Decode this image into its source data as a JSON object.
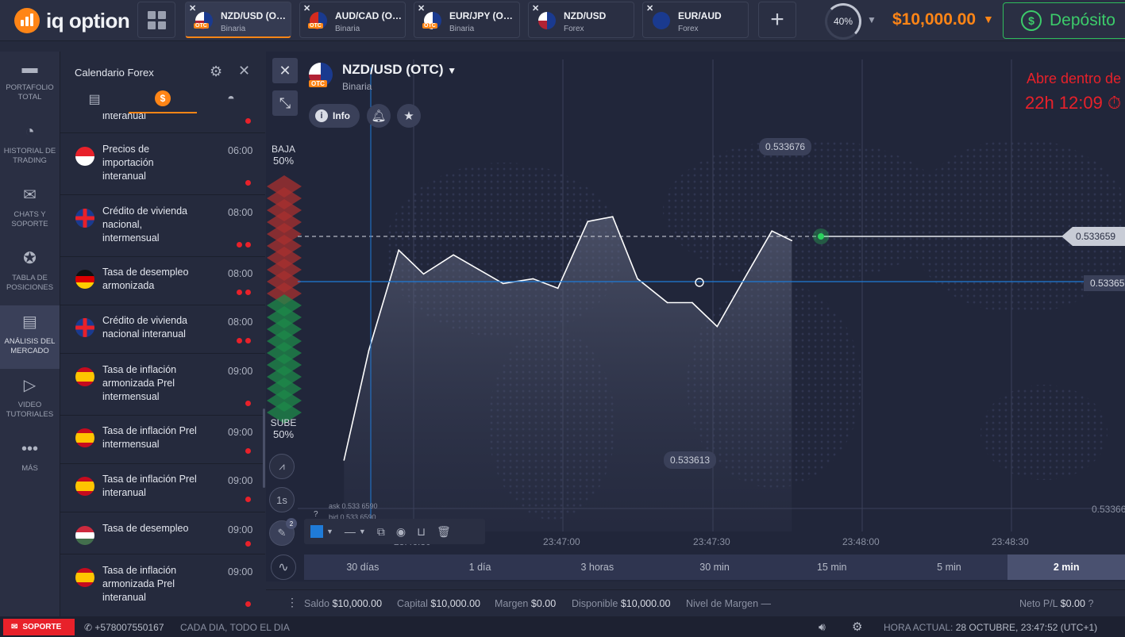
{
  "header": {
    "logo": "iq option",
    "tabs": [
      {
        "name": "NZD/USD (OTC)",
        "type": "Binaria",
        "otc": "OTC",
        "active": true
      },
      {
        "name": "AUD/CAD (OTC)",
        "type": "Binaria",
        "otc": "OTC",
        "active": false
      },
      {
        "name": "EUR/JPY (OTC)",
        "type": "Binaria",
        "otc": "OTC",
        "active": false
      },
      {
        "name": "NZD/USD",
        "type": "Forex",
        "otc": "",
        "active": false
      },
      {
        "name": "EUR/AUD",
        "type": "Forex",
        "otc": "",
        "active": false
      }
    ],
    "close_glyph": "✕",
    "add_glyph": "+",
    "profit_percent": "40%",
    "balance": "$10,000.00",
    "deposit_label": "Depósito"
  },
  "sidebar": {
    "items": [
      {
        "label": "PORTAFOLIO TOTAL",
        "icon": "briefcase-icon",
        "glyph": "▬"
      },
      {
        "label": "HISTORIAL DE TRADING",
        "icon": "history-icon",
        "glyph": "◔"
      },
      {
        "label": "CHATS Y SOPORTE",
        "icon": "chat-icon",
        "glyph": "✉"
      },
      {
        "label": "TABLA DE POSICIONES",
        "icon": "medal-icon",
        "glyph": "✪"
      },
      {
        "label": "ANÁLISIS DEL MERCADO",
        "icon": "newspaper-icon",
        "glyph": "▤",
        "active": true
      },
      {
        "label": "VIDEO TUTORIALES",
        "icon": "play-icon",
        "glyph": "▷"
      },
      {
        "label": "MÁS",
        "icon": "more-icon",
        "glyph": "•••"
      }
    ]
  },
  "calendar": {
    "title": "Calendario Forex",
    "partial_row": "interanual",
    "events": [
      {
        "flag": "sg",
        "name": "Precios de importación interanual",
        "time": "06:00",
        "impact": 1
      },
      {
        "flag": "gb",
        "name": "Crédito de vivienda nacional, intermensual",
        "time": "08:00",
        "impact": 2
      },
      {
        "flag": "de",
        "name": "Tasa de desempleo armonizada",
        "time": "08:00",
        "impact": 2
      },
      {
        "flag": "gb",
        "name": "Crédito de vivienda nacional interanual",
        "time": "08:00",
        "impact": 2
      },
      {
        "flag": "es",
        "name": "Tasa de inflación armonizada Prel intermensual",
        "time": "09:00",
        "impact": 1
      },
      {
        "flag": "es",
        "name": "Tasa de inflación Prel intermensual",
        "time": "09:00",
        "impact": 1
      },
      {
        "flag": "es",
        "name": "Tasa de inflación Prel interanual",
        "time": "09:00",
        "impact": 1
      },
      {
        "flag": "hu",
        "name": "Tasa de desempleo",
        "time": "09:00",
        "impact": 1
      },
      {
        "flag": "es",
        "name": "Tasa de inflación armonizada Prel interanual",
        "time": "09:00",
        "impact": 1
      }
    ]
  },
  "chart": {
    "asset_title": "NZD/USD (OTC)",
    "asset_type": "Binaria",
    "info_label": "Info",
    "timer_line1": "Abre dentro de",
    "timer_line2": "22h 12:09",
    "baja_label": "BAJA",
    "baja_pct": "50%",
    "sube_label": "SUBE",
    "sube_pct": "50%",
    "current_price": "0.533659",
    "blue_line_price": "0.53365",
    "high_label": "0.533676",
    "low_label": "0.533613",
    "axis_price": "0.53366",
    "ask": "ask 0.533 6590",
    "bid": "bid 0.533 6590",
    "interval": "1s",
    "draw_count": "2",
    "x_labels": [
      "23:46:30",
      "23:47:00",
      "23:47:30",
      "23:48:00",
      "23:48:30"
    ],
    "colors": {
      "line": "#ffffff",
      "current": "#2bd45e",
      "blue_line": "#1f7bd8",
      "up": "#1e8a4a",
      "down": "#a8302f"
    }
  },
  "chart_data": {
    "type": "line",
    "xlabel": "",
    "ylabel": "",
    "x": [
      "23:46:16",
      "23:46:21",
      "23:46:27",
      "23:46:32",
      "23:46:38",
      "23:46:43",
      "23:46:48",
      "23:46:54",
      "23:46:59",
      "23:47:05",
      "23:47:10",
      "23:47:15",
      "23:47:21",
      "23:47:26",
      "23:47:31",
      "23:47:37",
      "23:47:42",
      "23:47:46"
    ],
    "values": [
      0.533613,
      0.533636,
      0.533657,
      0.533652,
      0.533656,
      0.533653,
      0.53365,
      0.533651,
      0.533649,
      0.533663,
      0.533664,
      0.533651,
      0.533646,
      0.533646,
      0.533641,
      0.533652,
      0.533661,
      0.533659
    ],
    "high": 0.533676,
    "low": 0.533613
  },
  "drawbar": {
    "line_style": "—"
  },
  "periods": [
    {
      "label": "30 días"
    },
    {
      "label": "1 día"
    },
    {
      "label": "3 horas"
    },
    {
      "label": "30 min"
    },
    {
      "label": "15 min"
    },
    {
      "label": "5 min"
    },
    {
      "label": "2 min",
      "active": true
    }
  ],
  "status": {
    "saldo_label": "Saldo",
    "saldo": "$10,000.00",
    "capital_label": "Capital",
    "capital": "$10,000.00",
    "margen_label": "Margen",
    "margen": "$0.00",
    "disponible_label": "Disponible",
    "disponible": "$10,000.00",
    "nivel_label": "Nivel de Margen",
    "nivel": "—",
    "neto_label": "Neto P/L",
    "neto": "$0.00"
  },
  "bottom": {
    "support": "SOPORTE",
    "phone": "+578007550167",
    "hours": "CADA DIA, TODO EL DIA",
    "time_label": "HORA ACTUAL:",
    "time": "28 OCTUBRE, 23:47:52",
    "tz": "(UTC+1)"
  }
}
